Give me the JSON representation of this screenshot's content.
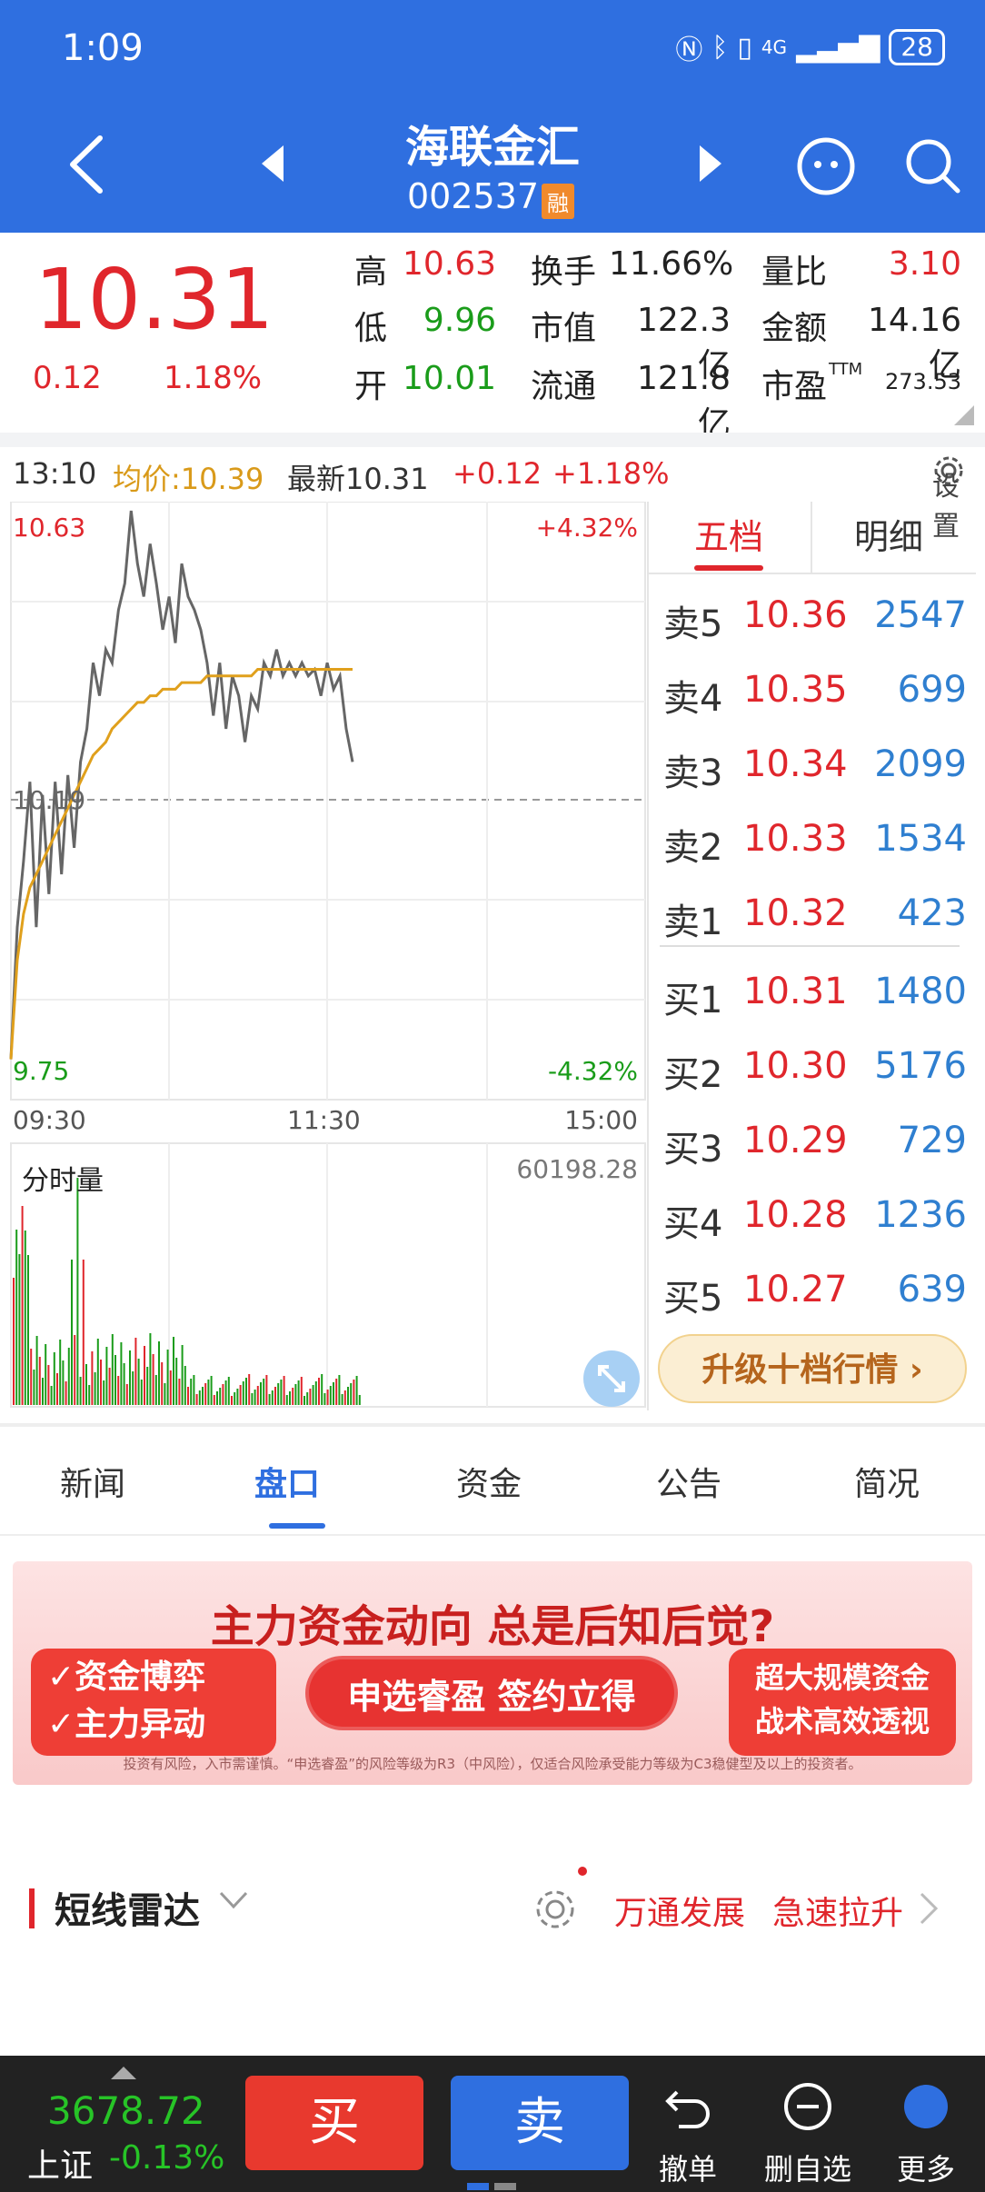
{
  "status": {
    "time": "1:09",
    "net": "4G",
    "battery": "28"
  },
  "header": {
    "name": "海联金汇",
    "code": "002537",
    "badge": "融"
  },
  "quote": {
    "price": "10.31",
    "change": "0.12",
    "change_pct": "1.18%",
    "fields": [
      {
        "label": "高",
        "value": "10.63"
      },
      {
        "label": "低",
        "value": "9.96"
      },
      {
        "label": "开",
        "value": "10.01"
      },
      {
        "label": "换手",
        "value": "11.66%"
      },
      {
        "label": "市值",
        "value": "122.3亿"
      },
      {
        "label": "流通",
        "value": "121.8亿"
      },
      {
        "label": "量比",
        "value": "3.10"
      },
      {
        "label": "金额",
        "value": "14.16亿"
      },
      {
        "label": "市盈",
        "sup": "TTM",
        "value": "273.53"
      }
    ]
  },
  "chart_head": {
    "time": "13:10",
    "avg": "均价:10.39",
    "latest": "最新10.31",
    "chg": "+0.12",
    "pct": "+1.18%",
    "settings": "设置"
  },
  "chart": {
    "y_max_label": "10.63",
    "y_min_label": "9.75",
    "y_ref_label": "10.19",
    "pct_max": "+4.32%",
    "pct_min": "-4.32%",
    "x_labels": [
      "09:30",
      "11:30",
      "15:00"
    ],
    "vol_label": "分时量",
    "vol_max": "60198.28"
  },
  "chart_data": {
    "type": "line",
    "title": "",
    "ylim": [
      9.75,
      10.63
    ],
    "series": [
      {
        "values": [
          9.8,
          10.0,
          10.1,
          10.22,
          10.0,
          10.2,
          10.05,
          10.22,
          10.08,
          10.23,
          10.12,
          10.25,
          10.3,
          10.4,
          10.35,
          10.42,
          10.4,
          10.48,
          10.52,
          10.63,
          10.55,
          10.5,
          10.58,
          10.52,
          10.45,
          10.5,
          10.43,
          10.55,
          10.5,
          10.48,
          10.45,
          10.4,
          10.32,
          10.4,
          10.3,
          10.38,
          10.35,
          10.28,
          10.35,
          10.33,
          10.4,
          10.38,
          10.42,
          10.38,
          10.4,
          10.38,
          10.4,
          10.38,
          10.39,
          10.35,
          10.4,
          10.36,
          10.38,
          10.3,
          10.25
        ]
      },
      {
        "values": [
          9.8,
          9.95,
          10.02,
          10.06,
          10.08,
          10.1,
          10.12,
          10.14,
          10.16,
          10.18,
          10.2,
          10.22,
          10.24,
          10.26,
          10.27,
          10.28,
          10.3,
          10.31,
          10.32,
          10.33,
          10.34,
          10.34,
          10.35,
          10.35,
          10.36,
          10.36,
          10.36,
          10.37,
          10.37,
          10.37,
          10.37,
          10.38,
          10.38,
          10.38,
          10.38,
          10.38,
          10.38,
          10.38,
          10.38,
          10.39,
          10.39,
          10.39,
          10.39,
          10.39,
          10.39,
          10.39,
          10.39,
          10.39,
          10.39,
          10.39,
          10.39,
          10.39,
          10.39,
          10.39,
          10.39
        ]
      }
    ]
  },
  "order_book": {
    "tabs": [
      "五档",
      "明细"
    ],
    "asks": [
      {
        "label": "卖5",
        "price": "10.36",
        "vol": "2547"
      },
      {
        "label": "卖4",
        "price": "10.35",
        "vol": "699"
      },
      {
        "label": "卖3",
        "price": "10.34",
        "vol": "2099"
      },
      {
        "label": "卖2",
        "price": "10.33",
        "vol": "1534"
      },
      {
        "label": "卖1",
        "price": "10.32",
        "vol": "423"
      }
    ],
    "bids": [
      {
        "label": "买1",
        "price": "10.31",
        "vol": "1480"
      },
      {
        "label": "买2",
        "price": "10.30",
        "vol": "5176"
      },
      {
        "label": "买3",
        "price": "10.29",
        "vol": "729"
      },
      {
        "label": "买4",
        "price": "10.28",
        "vol": "1236"
      },
      {
        "label": "买5",
        "price": "10.27",
        "vol": "639"
      }
    ],
    "upgrade": "升级十档行情 ›"
  },
  "tabs": [
    "新闻",
    "盘口",
    "资金",
    "公告",
    "简况"
  ],
  "banner": {
    "title": "主力资金动向 总是后知后觉?",
    "left1": "✓资金博弈",
    "left2": "✓主力异动",
    "button": "申选睿盈 签约立得",
    "right1": "超大规模资金",
    "right2": "战术高效透视",
    "disclaimer": "投资有风险，入市需谨慎。“申选睿盈”的风险等级为R3（中风险），仅适合风险承受能力等级为C3稳健型及以上的投资者。"
  },
  "radar": {
    "title": "短线雷达",
    "tag1": "万通发展",
    "tag2": "急速拉升"
  },
  "bottom": {
    "index_value": "3678.72",
    "index_name": "上证",
    "index_pct": "-0.13%",
    "buy": "买",
    "sell": "卖",
    "items": [
      "撤单",
      "删自选",
      "更多"
    ]
  }
}
